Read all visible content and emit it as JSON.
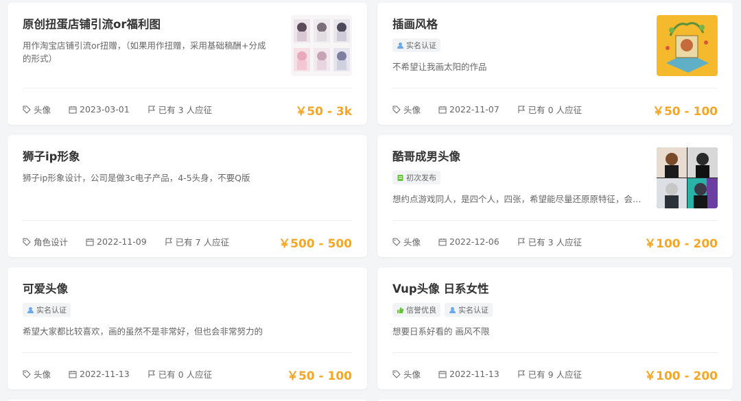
{
  "theme": {
    "accent": "#f5a623",
    "background": "#f4f5f7"
  },
  "cards": [
    {
      "title": "原创扭蛋店铺引流or福利图",
      "description": "用作淘宝店铺引流or扭赠，（如果用作扭赠，采用基础稿酬+分成的形式）",
      "category": "头像",
      "date": "2023-03-01",
      "applicants": "已有 3 人应征",
      "price": "￥50 - 3k",
      "thumbnail": "anime-girls-grid"
    },
    {
      "title": "插画风格",
      "badges": [
        {
          "icon": "user-verified-icon",
          "label": "实名认证"
        }
      ],
      "description": "不希望让我画太阳的作品",
      "category": "头像",
      "date": "2022-11-07",
      "applicants": "已有 0 人应征",
      "price": "￥50 - 100",
      "thumbnail": "yellow-illustration"
    },
    {
      "title": "狮子ip形象",
      "description": "狮子ip形象设计，公司是做3c电子产品，4-5头身，不要Q版",
      "category": "角色设计",
      "date": "2022-11-09",
      "applicants": "已有 7 人应征",
      "price": "￥500 - 500"
    },
    {
      "title": "酷哥成男头像",
      "badges": [
        {
          "icon": "first-post-icon",
          "label": "初次发布"
        }
      ],
      "description": "想约点游戏同人，是四个人，四张，希望能尽量还原原特征，会…",
      "category": "头像",
      "date": "2022-12-06",
      "applicants": "已有 3 人应征",
      "price": "￥100 - 200",
      "thumbnail": "anime-men-grid"
    },
    {
      "title": "可爱头像",
      "badges": [
        {
          "icon": "user-verified-icon",
          "label": "实名认证"
        }
      ],
      "description": "希望大家都比较喜欢，画的虽然不是非常好，但也会非常努力的",
      "category": "头像",
      "date": "2022-11-13",
      "applicants": "已有 0 人应征",
      "price": "￥50 - 100"
    },
    {
      "title": "Vup头像 日系女性",
      "badges": [
        {
          "icon": "thumbs-up-icon",
          "label": "信誉优良"
        },
        {
          "icon": "user-verified-icon",
          "label": "实名认证"
        }
      ],
      "description": "想要日系好看的 画风不限",
      "category": "头像",
      "date": "2022-11-13",
      "applicants": "已有 9 人应征",
      "price": "￥100 - 200"
    }
  ]
}
